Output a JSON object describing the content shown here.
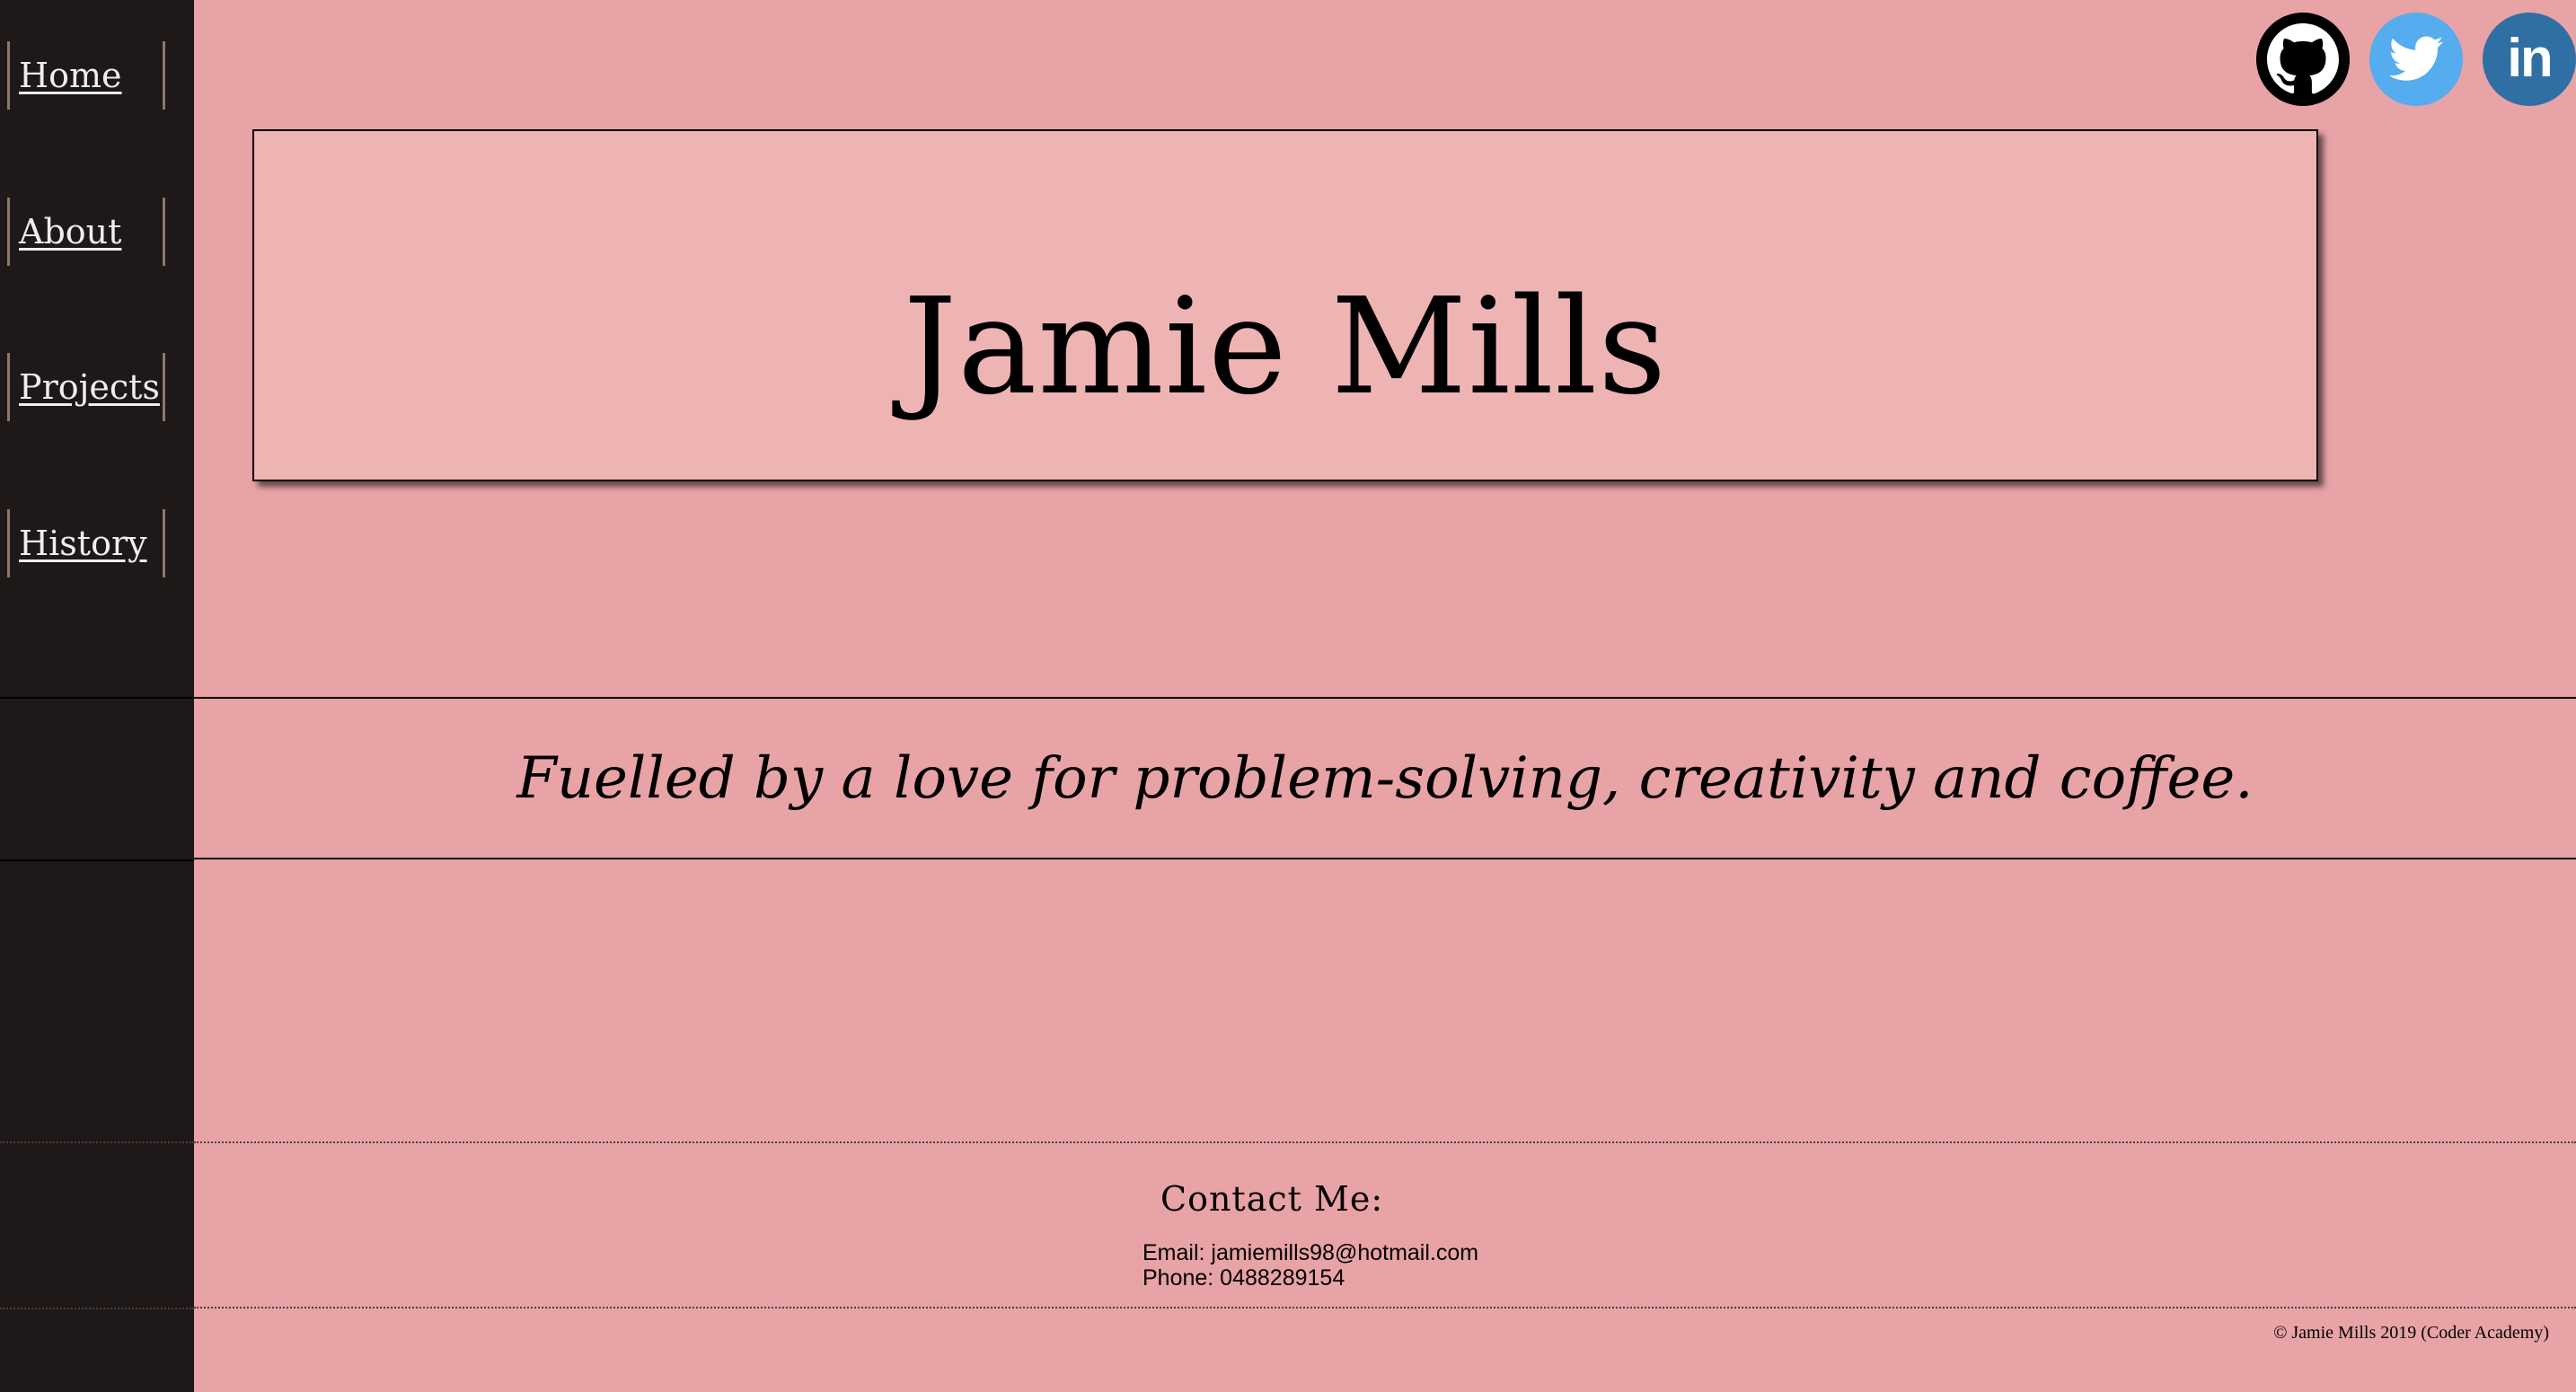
{
  "nav": {
    "items": [
      {
        "label": "Home"
      },
      {
        "label": "About"
      },
      {
        "label": "Projects"
      },
      {
        "label": "History"
      }
    ]
  },
  "social": {
    "github": {
      "icon": "github-icon",
      "color": "#000000"
    },
    "twitter": {
      "icon": "twitter-icon",
      "color": "#55acee"
    },
    "linkedin": {
      "icon": "linkedin-icon",
      "label": "in",
      "color": "#2f6fa4"
    }
  },
  "hero": {
    "title": "Jamie Mills"
  },
  "tagline": {
    "text": "Fuelled by a love for problem-solving, creativity and coffee."
  },
  "contact": {
    "heading": "Contact Me:",
    "email_line": "Email: jamiemills98@hotmail.com",
    "phone_line": "Phone: 0488289154"
  },
  "footer": {
    "copyright": "© Jamie Mills 2019 (Coder Academy)"
  },
  "colors": {
    "background": "#e8a3a6",
    "sidebar": "#1f1818",
    "title_box": "#edb4b3",
    "nav_text": "#f2ecec",
    "nav_border": "#8a7a66"
  }
}
